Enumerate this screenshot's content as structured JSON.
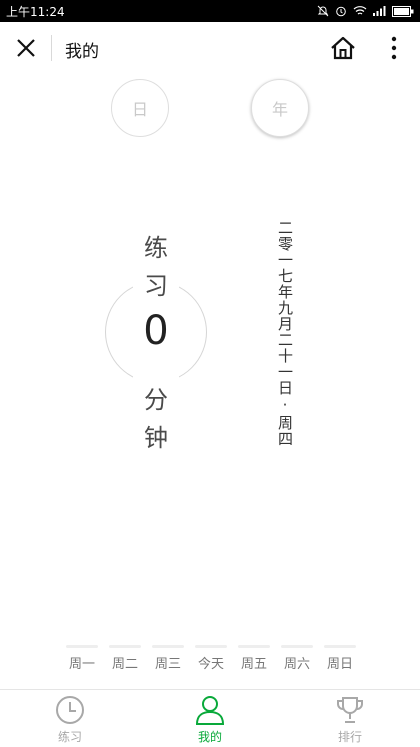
{
  "status_bar": {
    "time": "上午11:24",
    "icons": [
      "bell-mute-icon",
      "alarm-icon",
      "wifi-icon",
      "signal-icon",
      "battery-icon"
    ]
  },
  "nav": {
    "title": "我的",
    "icons": [
      "close-icon",
      "home-icon",
      "more-icon"
    ]
  },
  "period_toggle": {
    "day_label": "日",
    "year_label": "年"
  },
  "practice": {
    "chars_top": [
      "练",
      "习"
    ],
    "minutes": "0",
    "chars_bottom": [
      "分",
      "钟"
    ]
  },
  "date_vertical": "二零一七年九月二十一日·周四",
  "week": {
    "days": [
      "周一",
      "周二",
      "周三",
      "今天",
      "周五",
      "周六",
      "周日"
    ]
  },
  "tabs": [
    {
      "label": "练习",
      "icon": "clock-icon"
    },
    {
      "label": "我的",
      "icon": "person-icon"
    },
    {
      "label": "排行",
      "icon": "trophy-icon"
    }
  ],
  "colors": {
    "accent": "#09a93a",
    "inactive": "#a8a8a8"
  }
}
